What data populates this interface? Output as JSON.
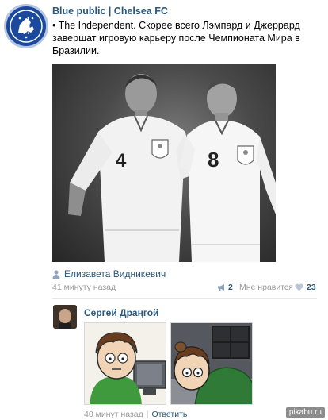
{
  "post": {
    "group_name": "Blue public | Chelsea FC",
    "text": "• The Independent. Скорее всего Лэмпард и Джеррард завершат игровую карьеру после Чемпионата Мира в Бразилии.",
    "photo": {
      "shirt_number_left": "4",
      "shirt_number_right": "8"
    },
    "author": "Елизавета Видникевич",
    "time": "41 минуту назад",
    "share_count": "2",
    "like_label": "Мне нравится",
    "like_count": "23"
  },
  "comment": {
    "author": "Сергей Драңгой",
    "time": "40 минут назад",
    "reply_label": "Ответить"
  },
  "watermark": "pikabu.ru",
  "icons": {
    "group_logo": "chelsea-lion-crest-icon",
    "author": "person-icon",
    "share": "megaphone-icon",
    "like": "heart-icon"
  },
  "colors": {
    "link": "#2b587a",
    "meta": "#999999",
    "crest_blue": "#1b4a9c"
  }
}
